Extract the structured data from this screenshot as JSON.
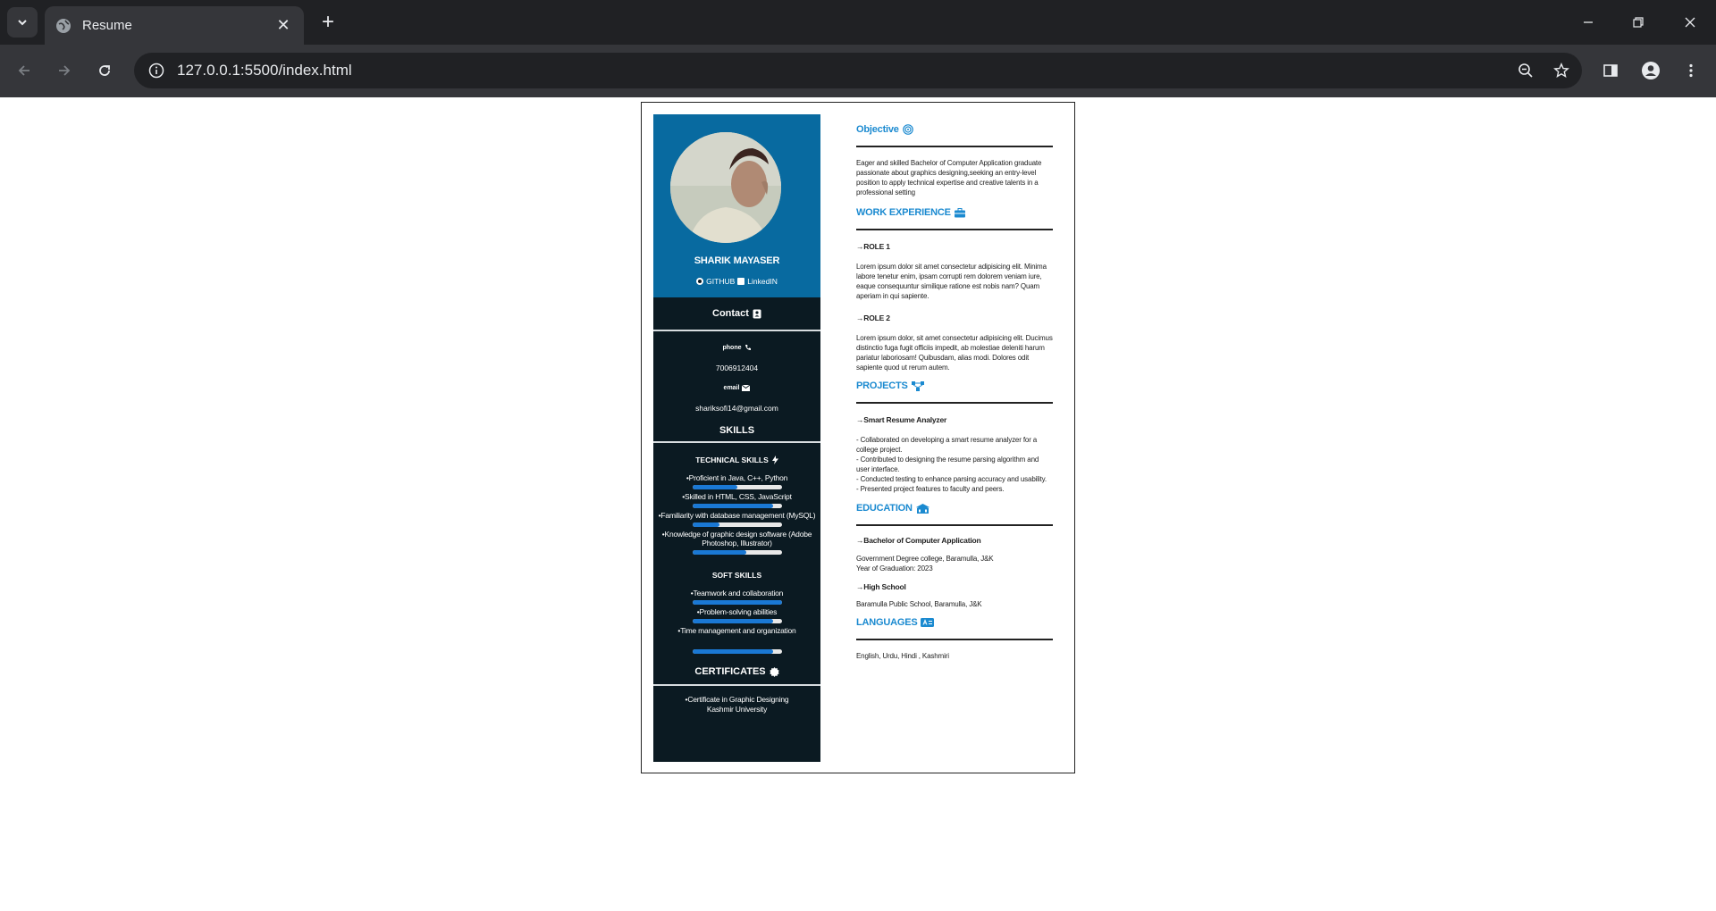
{
  "browser": {
    "tab_title": "Resume",
    "url": "127.0.0.1:5500/index.html"
  },
  "resume": {
    "name": "SHARIK MAYASER",
    "links": {
      "github": "GITHUB",
      "linkedin": "LinkedIN"
    },
    "contact": {
      "heading": "Contact",
      "phone_label": "phone",
      "phone": "7006912404",
      "email_label": "email",
      "email": "shariksofi14@gmail.com"
    },
    "skills": {
      "heading": "SKILLS",
      "technical_heading": "TECHNICAL SKILLS",
      "technical": [
        {
          "label": "•Proficient in Java, C++, Python",
          "level": 0.5
        },
        {
          "label": "•Skilled in HTML, CSS, JavaScript",
          "level": 0.9
        },
        {
          "label": "•Familiarity with database management (MySQL)",
          "level": 0.3
        },
        {
          "label": "•Knowledge of graphic design software (Adobe Photoshop, Illustrator)",
          "level": 0.6
        }
      ],
      "soft_heading": "SOFT SKILLS",
      "soft": [
        {
          "label": "•Teamwork and collaboration",
          "level": 1.0
        },
        {
          "label": "•Problem-solving abilities",
          "level": 0.9
        },
        {
          "label": "•Time management and organization",
          "level": 0.9
        }
      ]
    },
    "certificates": {
      "heading": "CERTIFICATES",
      "line1": "•Certificate in Graphic Designing",
      "line2": "Kashmir University"
    },
    "objective": {
      "heading": "Objective",
      "text": "Eager and skilled Bachelor of Computer Application graduate passionate about graphics designing,seeking an entry-level position to apply technical expertise and creative talents in a professional setting"
    },
    "work": {
      "heading": "WORK EXPERIENCE",
      "roles": [
        {
          "title": "→ROLE 1",
          "text": "Lorem ipsum dolor sit amet consectetur adipisicing elit. Minima labore tenetur enim, ipsam corrupti rem dolorem veniam iure, eaque consequuntur similique ratione est nobis nam? Quam aperiam in qui sapiente."
        },
        {
          "title": "→ROLE 2",
          "text": "Lorem ipsum dolor, sit amet consectetur adipisicing elit. Ducimus distinctio fuga fugit officiis impedit, ab molestiae deleniti harum pariatur laboriosam! Quibusdam, alias modi. Dolores odit sapiente quod ut rerum autem."
        }
      ]
    },
    "projects": {
      "heading": "PROJECTS",
      "title": "→Smart Resume Analyzer",
      "lines": [
        "- Collaborated on developing a smart resume analyzer for a college project.",
        "- Contributed to designing the resume parsing algorithm and user interface.",
        "- Conducted testing to enhance parsing accuracy and usability.",
        "- Presented project features to faculty and peers."
      ]
    },
    "education": {
      "heading": "EDUCATION",
      "degree": "→Bachelor of Computer Application",
      "college": "Government Degree college, Baramulla, J&K",
      "year": "Year of Graduation: 2023",
      "school_title": "→High School",
      "school": "Baramulla Public School, Baramulla, J&K"
    },
    "languages": {
      "heading": "LANGUAGES",
      "text": "English, Urdu, Hindi , Kashmiri"
    }
  }
}
